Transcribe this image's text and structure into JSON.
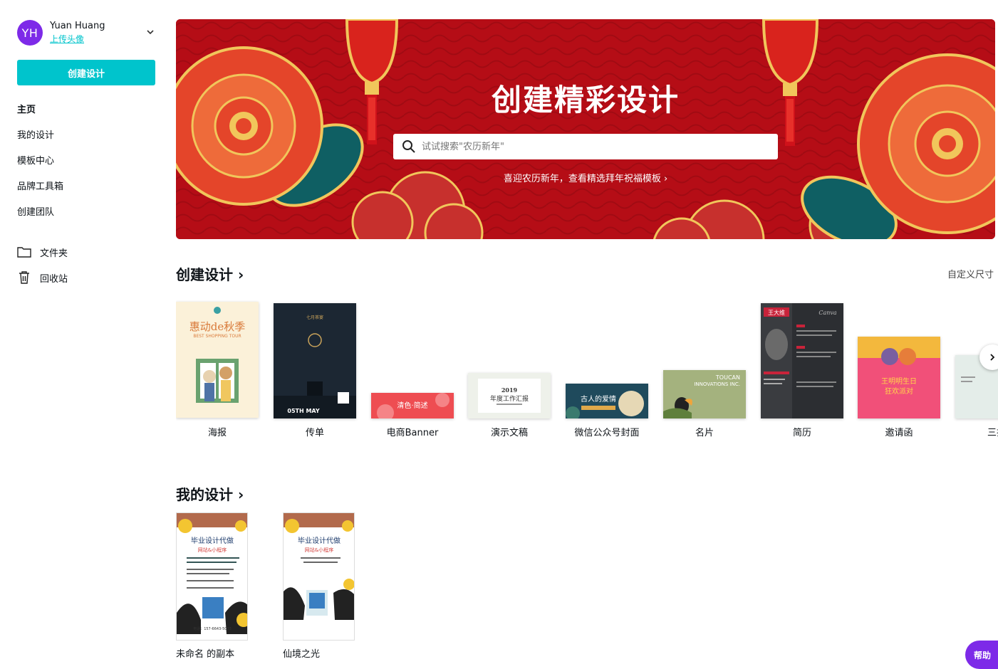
{
  "user": {
    "initials": "YH",
    "name": "Yuan Huang",
    "upload_label": "上传头像"
  },
  "sidebar": {
    "create_label": "创建设计",
    "items": [
      {
        "label": "主页"
      },
      {
        "label": "我的设计"
      },
      {
        "label": "模板中心"
      },
      {
        "label": "品牌工具箱"
      },
      {
        "label": "创建团队"
      }
    ],
    "secondary": [
      {
        "label": "文件夹",
        "icon": "folder-icon"
      },
      {
        "label": "回收站",
        "icon": "trash-icon"
      }
    ]
  },
  "hero": {
    "title": "创建精彩设计",
    "search_placeholder": "试试搜索\"农历新年\"",
    "link_text": "喜迎农历新年，查看精选拜年祝福模板 ›",
    "colors": {
      "background": "#b50d16",
      "flower": "#e4452a",
      "leaf": "#0f5f63",
      "gold": "#f1c65b"
    }
  },
  "create_section": {
    "title": "创建设计 ›",
    "custom_size": "自定义尺寸",
    "types": [
      {
        "label": "海报",
        "thumb_text": "惠动de秋季",
        "thumb_sub": "BEST SHOPPING TOUR"
      },
      {
        "label": "传单",
        "thumb_text": "05TH MAY",
        "thumb_sub": "七月茶宴"
      },
      {
        "label": "电商Banner",
        "thumb_text": "清色·简述"
      },
      {
        "label": "演示文稿",
        "thumb_text": "2019",
        "thumb_sub": "年度工作汇报"
      },
      {
        "label": "微信公众号封面",
        "thumb_text": "古人的爱情"
      },
      {
        "label": "名片",
        "thumb_text": "TOUCAN",
        "thumb_sub": "INNOVATIONS INC."
      },
      {
        "label": "简历",
        "thumb_text": "王大维",
        "thumb_sub": "Canva"
      },
      {
        "label": "邀请函",
        "thumb_text": "王明明生日",
        "thumb_sub": "狂欢派对"
      },
      {
        "label": "三折"
      }
    ]
  },
  "my_designs": {
    "title": "我的设计 ›",
    "items": [
      {
        "label": "未命名 的副本",
        "thumb_text": "毕业设计代做",
        "thumb_sub": "网站&小程序",
        "phone": "电话：157-6643-5033"
      },
      {
        "label": "仙境之光",
        "thumb_text": "毕业设计代做",
        "thumb_sub": "网站&小程序"
      }
    ]
  },
  "help_label": "帮助"
}
